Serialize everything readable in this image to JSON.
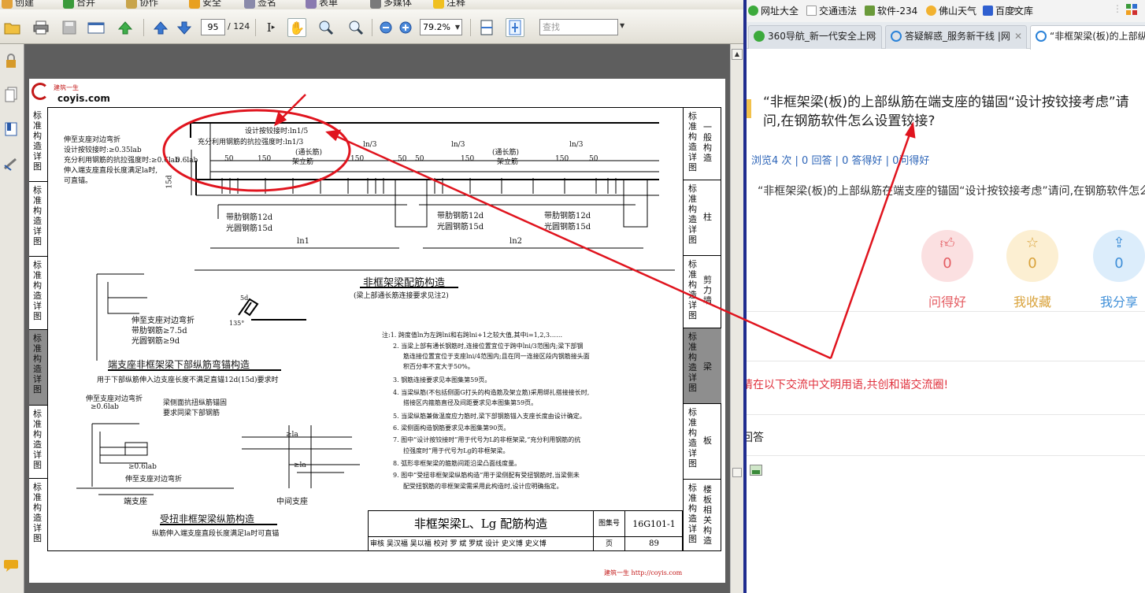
{
  "pdf_reader": {
    "menubar": {
      "items": [
        "创建",
        "合并",
        "协作",
        "安全",
        "签名",
        "表单",
        "多媒体",
        "注释"
      ]
    },
    "toolbar": {
      "current_page": "95",
      "total_pages": "/ 124",
      "zoom": "79.2%",
      "search_placeholder": "查找"
    },
    "page": {
      "logo_cn": "建筑一生",
      "logo_url": "coyis.com",
      "left_strip": [
        {
          "label": "标准构造详图"
        },
        {
          "label": "标准构造详图"
        },
        {
          "label": "标准构造详图"
        },
        {
          "label": "标准构造详图"
        },
        {
          "label": "标准构造详图"
        },
        {
          "label": "标准构造详图"
        }
      ],
      "right_strip": [
        {
          "left": "标准构造详图",
          "right": "一般构造"
        },
        {
          "left": "标准构造详图",
          "right": "柱"
        },
        {
          "left": "标准构造详图",
          "right": "剪力墙"
        },
        {
          "left": "标准构造详图",
          "right": "梁"
        },
        {
          "left": "标准构造详图",
          "right": "板"
        },
        {
          "left": "标准构造详图",
          "right": "楼板相关构造"
        }
      ],
      "drawing_texts": {
        "design_hinge": "设计按铰接时:ln1/5",
        "full_strength": "充分利用钢筋的抗拉强度时:ln1/3",
        "through_bar": "(通长筋)",
        "frame_bar": "架立筋",
        "ln3": "ln/3",
        "d50": "50",
        "d150": "150",
        "d15": "15d",
        "d06lab": "0.6lab",
        "left_note_1": "伸至支座对边弯折",
        "left_note_2": "设计按铰接时:≥0.35lab",
        "left_note_3": "充分利用钢筋的抗拉强度时:≥0.6lab",
        "left_note_4": "伸入端支座直段长度满足la时,",
        "left_note_5": "可直锚。",
        "rib_bar_1": "带肋钢筋12d",
        "plain_bar_1": "光圆钢筋15d",
        "ln1": "ln1",
        "ln2": "ln2",
        "main_title": "非框架梁配筋构造",
        "main_subtitle": "(梁上部通长筋连接要求见注2)",
        "bend_note_1": "伸至支座对边弯折",
        "bend_note_2": "带肋钢筋≥7.5d",
        "bend_note_3": "光圆钢筋≥9d",
        "angle_135": "135°",
        "sd5": "5d",
        "end_title": "端支座非框架梁下部纵筋弯锚构造",
        "end_sub": "用于下部纵筋伸入边支座长度不满足直锚12d(15d)要求时",
        "tor_note_1": "伸至支座对边弯折",
        "tor_note_2": "≥0.6lab",
        "tor_note_3": "梁侧面抗扭纵筋锚固",
        "tor_note_4": "要求同梁下部钢筋",
        "tor_note_5": "≥0.6lab",
        "tor_note_6": "伸至支座对边弯折",
        "end_support": "端支座",
        "mid_support": "中间支座",
        "ge_la": "≥la",
        "tor_title": "受扭非框架梁纵筋构造",
        "tor_sub": "纵筋伸入端支座直段长度满足la时可直锚"
      },
      "notes": [
        "注:1. 跨度值ln为左跨lni和右跨lni+1之较大值,其中i=1,2,3……",
        "2. 当梁上部有通长钢筋时,连接位置宜位于跨中lni/3范围内;梁下部钢",
        "筋连接位置宜位于支座lni/4范围内;且在同一连接区段内钢筋接头面",
        "积百分率不宜大于50%。",
        "3. 钢筋连接要求见本图集第59页。",
        "4. 当梁纵筋(不包括侧面G打头的构造筋及架立筋)采用绑扎搭接接长时,",
        "搭接区内箍筋直径及间距要求见本图集第59页。",
        "5. 当梁纵筋兼做温度应力筋时,梁下部钢筋锚入支座长度由设计确定。",
        "6. 梁侧面构造钢筋要求见本图集第90页。",
        "7. 图中“设计按铰接时”用于代号为L的非框架梁,“充分利用钢筋的抗",
        "拉强度时”用于代号为Lg的非框架梁。",
        "8. 弧形非框架梁的箍筋间距沿梁凸面线度量。",
        "9. 图中“受扭非框架梁纵筋构造”用于梁侧配有受扭钢筋时,当梁侧未",
        "配受扭钢筋的非框架梁需采用此构造时,设计应明确指定。"
      ],
      "title_block": {
        "title": "非框架梁L、Lg 配筋构造",
        "atlas_label": "图集号",
        "atlas_no": "16G101-1",
        "sign_row": "审核 吴汉福 吴以福 校对 罗 斌 罗斌 设计 史义博 史义博",
        "page_label": "页",
        "page_no": "89"
      },
      "footer_url": "建筑一生 http://coyis.com"
    }
  },
  "browser": {
    "favorites": [
      "网址大全",
      "交通违法",
      "软件-234",
      "佛山天气",
      "百度文库"
    ],
    "favorites_more": "»",
    "tabs": [
      {
        "label": "360导航_新一代安全上网"
      },
      {
        "label": "答疑解惑_服务新干线 |网"
      },
      {
        "label": "“非框架梁(板)的上部纵"
      }
    ],
    "question": {
      "title": "“非框架梁(板)的上部纵筋在端支座的锚固“设计按铰接考虑”请问,在钢筋软件怎么设置铰接?",
      "stats": "浏览4 次 | 0 回答 | 0 答得好 | 0问得好",
      "description": "“非框架梁(板)的上部纵筋在端支座的锚固“设计按铰接考虑”请问,在钢筋软件怎么设置铰接?"
    },
    "actions": [
      {
        "label": "问得好",
        "count": "0",
        "icon": "thumbs-up-icon",
        "color": "#e45c62",
        "bg": "#fbe0e1"
      },
      {
        "label": "我收藏",
        "count": "0",
        "icon": "star-icon",
        "color": "#d9a23a",
        "bg": "#fcefd2"
      },
      {
        "label": "我分享",
        "count": "0",
        "icon": "share-icon",
        "color": "#3f8fd8",
        "bg": "#dcedfb"
      }
    ],
    "notice": "请在以下交流中文明用语,共创和谐交流圈!",
    "answer_heading": "回答"
  },
  "colors": {
    "annotation_red": "#e0141e",
    "link_blue": "#2d65b8",
    "splitter_blue": "#1f2c8f"
  }
}
